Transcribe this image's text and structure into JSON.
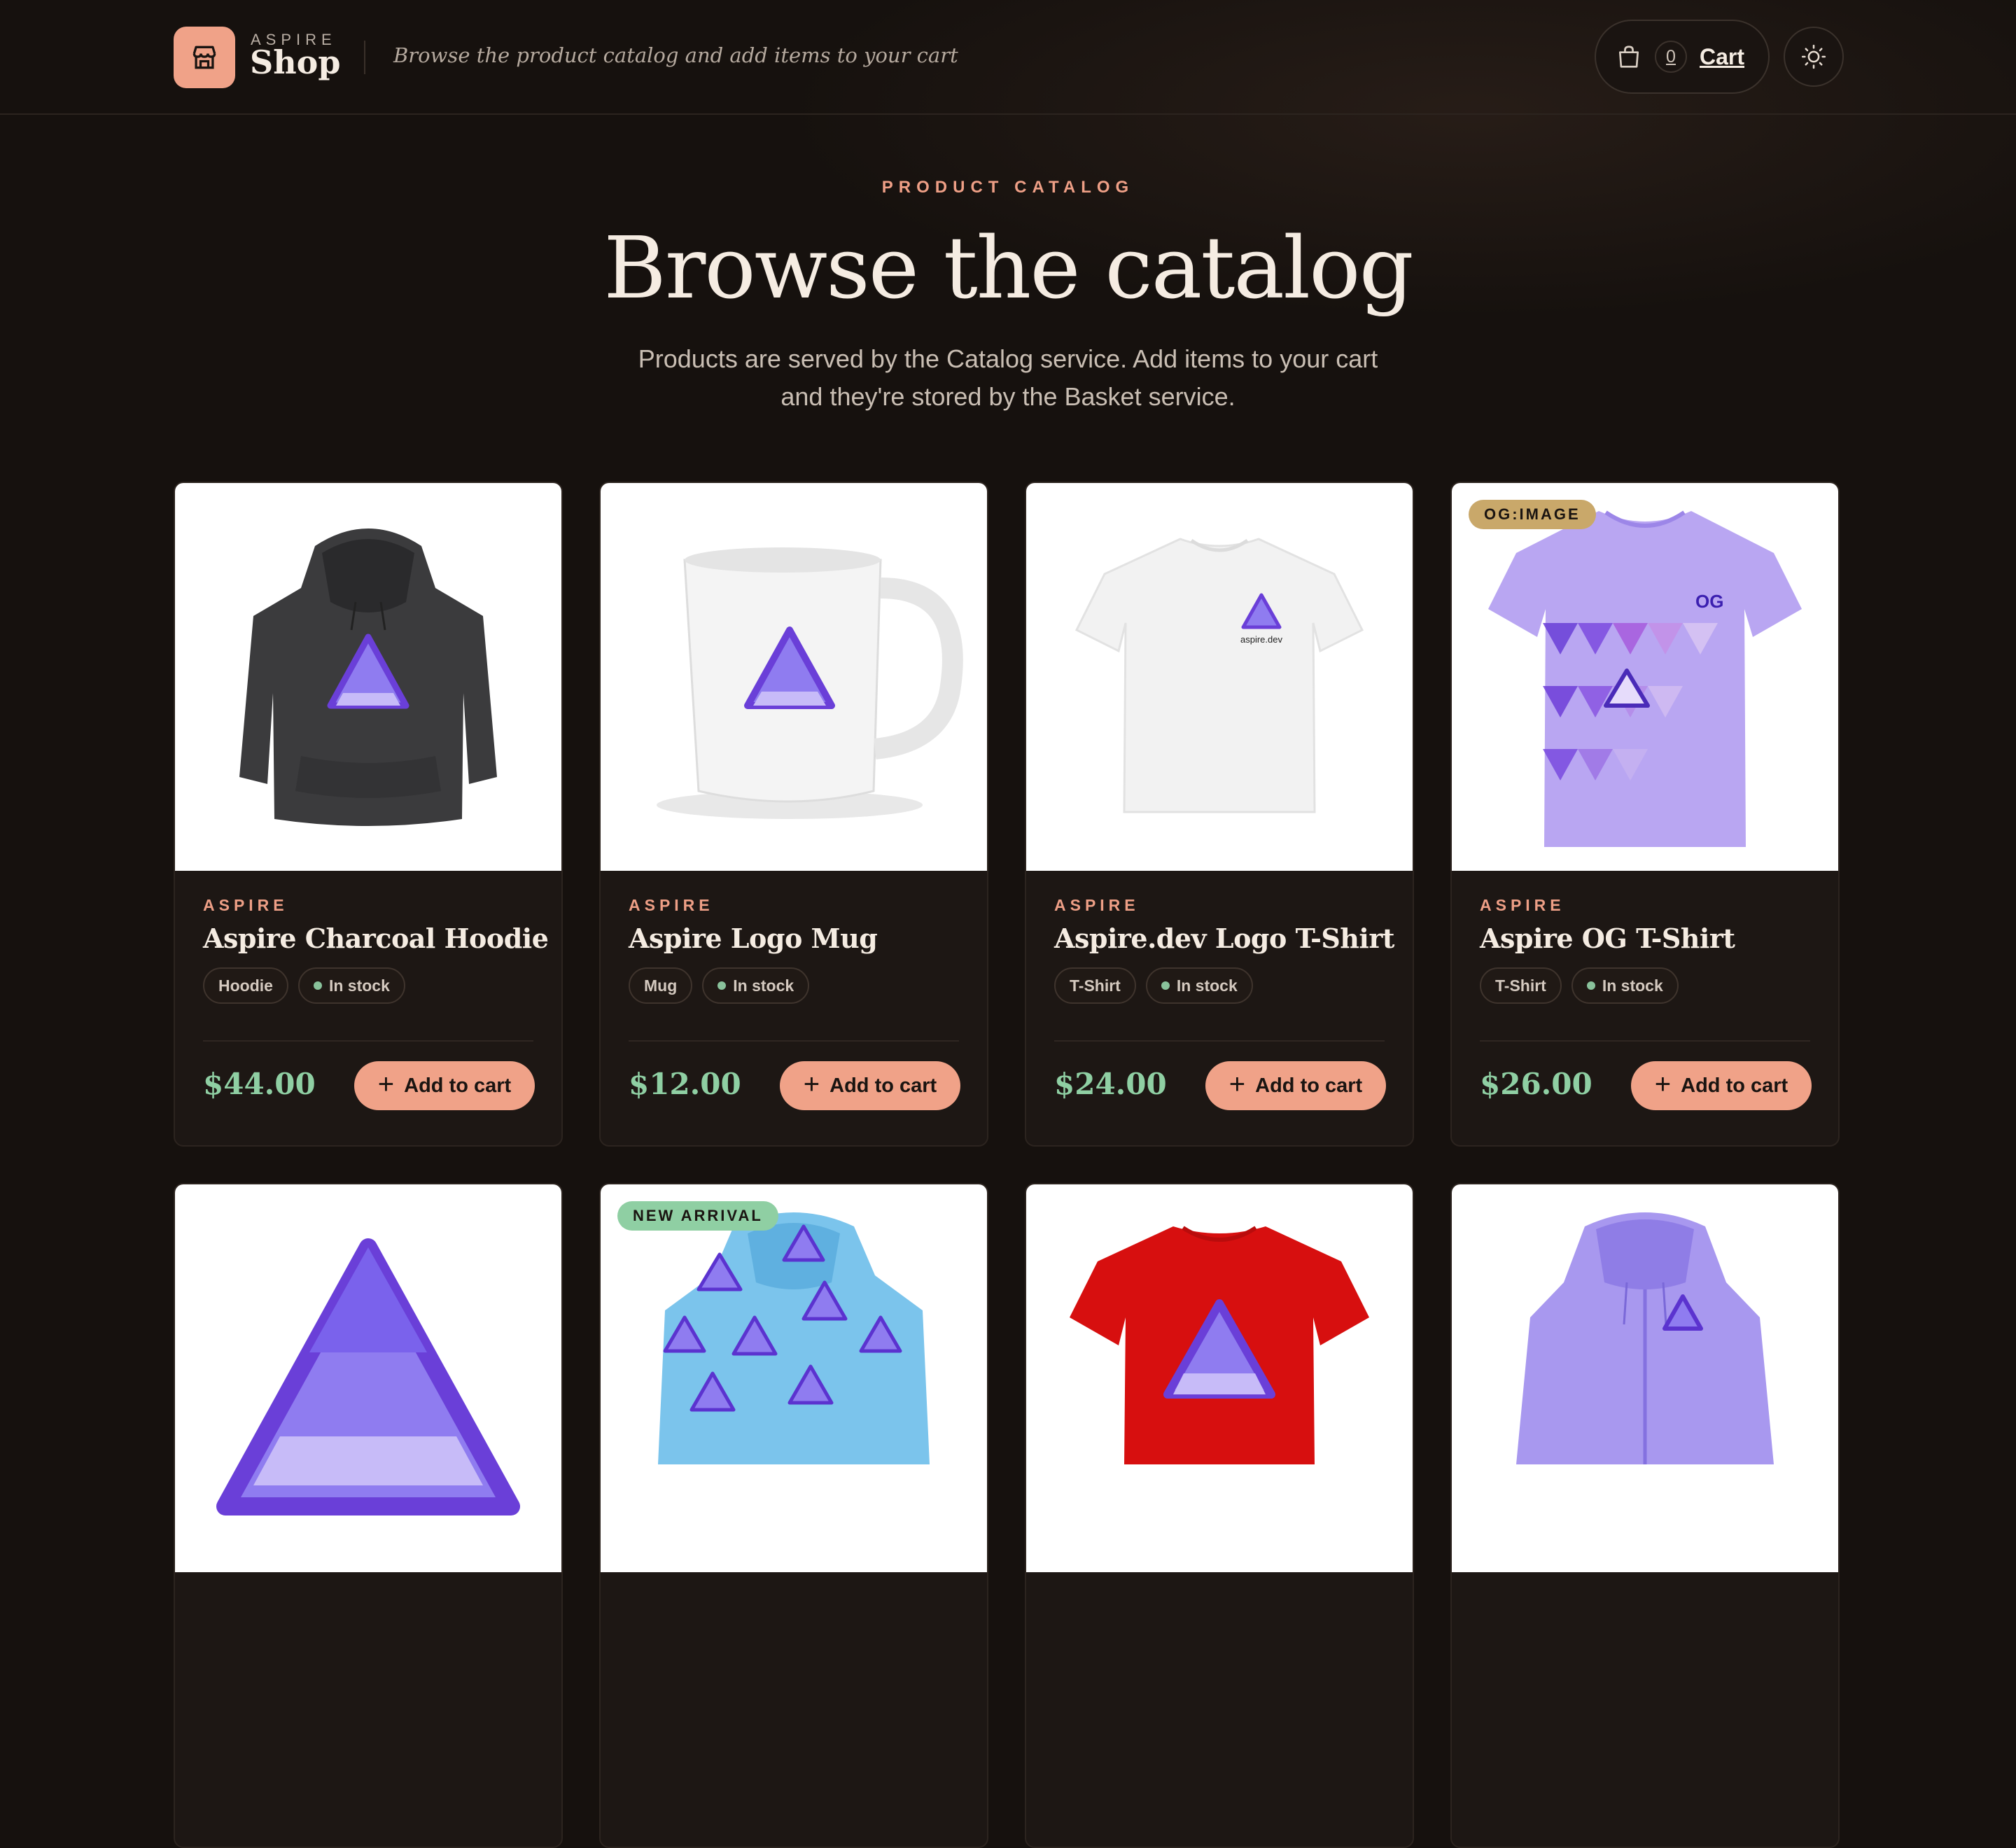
{
  "header": {
    "brand_top": "ASPIRE",
    "brand_name": "Shop",
    "tagline": "Browse the product catalog and add items to your cart",
    "cart_count": "0",
    "cart_label": "Cart",
    "icons": {
      "logo": "storefront-icon",
      "cart": "shopping-bag-icon",
      "theme": "sun-icon"
    }
  },
  "hero": {
    "eyebrow": "PRODUCT CATALOG",
    "title": "Browse the catalog",
    "subtitle": "Products are served by the Catalog service. Add items to your cart and they're stored by the Basket service."
  },
  "add_to_cart_label": "Add to cart",
  "products": [
    {
      "brand": "ASPIRE",
      "name": "Aspire Charcoal Hoodie",
      "category": "Hoodie",
      "stock": "In stock",
      "price": "$44.00",
      "badge": ""
    },
    {
      "brand": "ASPIRE",
      "name": "Aspire Logo Mug",
      "category": "Mug",
      "stock": "In stock",
      "price": "$12.00",
      "badge": ""
    },
    {
      "brand": "ASPIRE",
      "name": "Aspire.dev Logo T-Shirt",
      "category": "T-Shirt",
      "stock": "In stock",
      "price": "$24.00",
      "badge": "",
      "print_text": "aspire.dev"
    },
    {
      "brand": "ASPIRE",
      "name": "Aspire OG T-Shirt",
      "category": "T-Shirt",
      "stock": "In stock",
      "price": "$26.00",
      "badge": "OG:IMAGE",
      "print_text": "OG"
    },
    {
      "badge": ""
    },
    {
      "badge": "NEW ARRIVAL"
    },
    {
      "badge": ""
    },
    {
      "badge": ""
    }
  ],
  "colors": {
    "accent": "#f0a288",
    "price": "#8fcfa3",
    "background": "#16110e",
    "badge_og": "#c9a86a",
    "badge_new": "#8fcfa3",
    "logo_purple": "#6a3fd8"
  }
}
